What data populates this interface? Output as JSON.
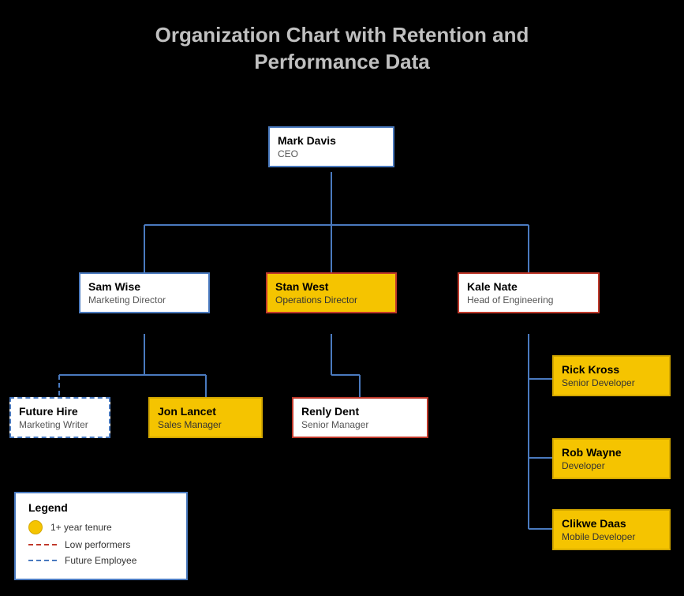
{
  "title": {
    "line1": "Organization Chart with Retention and",
    "line2": "Performance Data"
  },
  "nodes": {
    "mark_davis": {
      "name": "Mark Davis",
      "role": "CEO",
      "type": "normal"
    },
    "sam_wise": {
      "name": "Sam Wise",
      "role": "Marketing Director",
      "type": "normal"
    },
    "stan_west": {
      "name": "Stan West",
      "role": "Operations Director",
      "type": "yellow-red"
    },
    "kale_nate": {
      "name": "Kale Nate",
      "role": "Head of Engineering",
      "type": "red-border"
    },
    "future_hire": {
      "name": "Future Hire",
      "role": "Marketing Writer",
      "type": "dashed"
    },
    "jon_lancet": {
      "name": "Jon Lancet",
      "role": "Sales Manager",
      "type": "yellow"
    },
    "renly_dent": {
      "name": "Renly Dent",
      "role": "Senior Manager",
      "type": "red-border"
    },
    "rick_kross": {
      "name": "Rick Kross",
      "role": "Senior Developer",
      "type": "yellow"
    },
    "rob_wayne": {
      "name": "Rob Wayne",
      "role": "Developer",
      "type": "yellow"
    },
    "clikwe_daas": {
      "name": "Clikwe Daas",
      "role": "Mobile Developer",
      "type": "yellow"
    }
  },
  "legend": {
    "title": "Legend",
    "items": [
      {
        "icon": "circle-yellow",
        "label": "1+ year tenure"
      },
      {
        "icon": "dashed-red",
        "label": "Low performers"
      },
      {
        "icon": "dashed-blue",
        "label": "Future Employee"
      }
    ]
  }
}
